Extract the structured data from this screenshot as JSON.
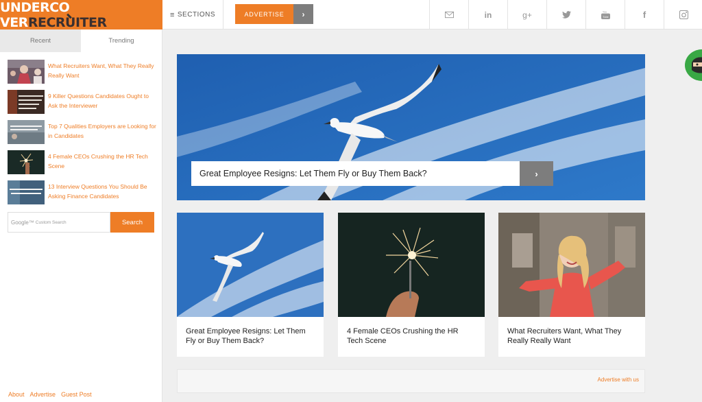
{
  "header": {
    "logo": {
      "part1": "UNDERC",
      "part2": "O",
      "part3": "VER",
      "part4": "RECRUITER"
    },
    "sections_label": "SECTIONS",
    "advertise_label": "ADVERTISE",
    "social_icons": [
      "mail-icon",
      "linkedin-icon",
      "google-plus-icon",
      "twitter-icon",
      "youtube-icon",
      "facebook-icon",
      "instagram-icon"
    ]
  },
  "sidebar": {
    "tabs": [
      {
        "label": "Recent"
      },
      {
        "label": "Trending"
      }
    ],
    "items": [
      {
        "title": " What Recruiters Want, What They Really Really Want"
      },
      {
        "title": " 9 Killer Questions Candidates Ought to Ask the Interviewer"
      },
      {
        "title": "Top 7 Qualities Employers are Looking for in Candidates"
      },
      {
        "title": "4 Female CEOs Crushing the HR Tech Scene"
      },
      {
        "title": " 13 Interview Questions You Should Be Asking Finance Candidates"
      }
    ],
    "search": {
      "placeholder_brand": "Google™",
      "placeholder": "Custom Search",
      "button": "Search"
    },
    "footer": [
      "About",
      "Advertise",
      "Guest Post"
    ]
  },
  "hero": {
    "title": "Great Employee Resigns: Let Them Fly or Buy Them Back?"
  },
  "cards": [
    {
      "title": "Great Employee Resigns: Let Them Fly or Buy Them Back?"
    },
    {
      "title": "4 Female CEOs Crushing the HR Tech Scene"
    },
    {
      "title": "What Recruiters Want, What They Really Really Want"
    }
  ],
  "ad_link": "Advertise with us",
  "colors": {
    "accent": "#ee7d26",
    "gray_button": "#7d7d7d"
  }
}
